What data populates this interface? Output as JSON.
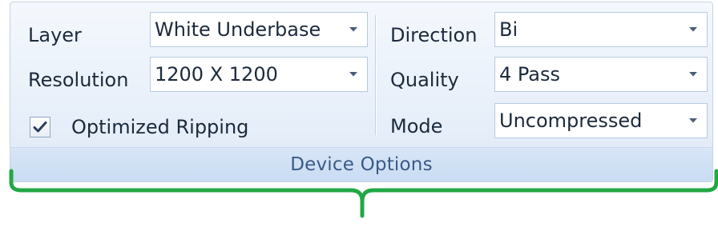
{
  "group": {
    "title": "Device Options"
  },
  "fields": {
    "layer": {
      "label": "Layer",
      "value": "White Underbase"
    },
    "resolution": {
      "label": "Resolution",
      "value": "1200 X 1200"
    },
    "direction": {
      "label": "Direction",
      "value": "Bi"
    },
    "quality": {
      "label": "Quality",
      "value": "4 Pass"
    },
    "mode": {
      "label": "Mode",
      "value": "Uncompressed"
    }
  },
  "checkbox": {
    "label": "Optimized Ripping",
    "checked": true
  },
  "icons": {
    "dropdown": "chevron-down-icon",
    "check": "check-icon"
  },
  "colors": {
    "bracket": "#22a845",
    "group_title": "#3b5a86"
  }
}
